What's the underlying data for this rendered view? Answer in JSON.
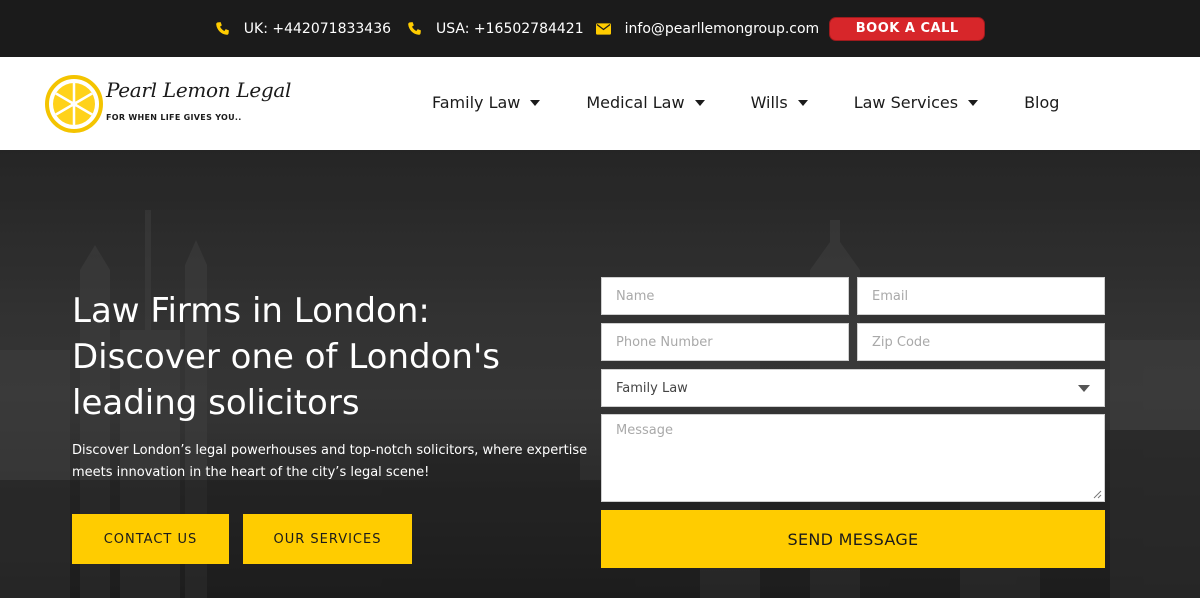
{
  "topbar": {
    "uk_phone": "UK: +442071833436",
    "usa_phone": "USA: +16502784421",
    "email": "info@pearllemongroup.com",
    "book_label": "BOOK A CALL",
    "icons": [
      "phone-icon",
      "phone-icon",
      "envelope-icon"
    ],
    "icon_color": "#ffcc00"
  },
  "header": {
    "logo_title": "Pearl Lemon Legal",
    "logo_tagline": "FOR WHEN LIFE GIVES YOU..",
    "nav": [
      {
        "label": "Family Law",
        "dropdown": true
      },
      {
        "label": "Medical Law",
        "dropdown": true
      },
      {
        "label": "Wills",
        "dropdown": true
      },
      {
        "label": "Law Services",
        "dropdown": true
      },
      {
        "label": "Blog",
        "dropdown": false
      }
    ]
  },
  "hero": {
    "title_lines": [
      "Law Firms in London:",
      "Discover one of London's",
      "leading solicitors"
    ],
    "subtitle_lines": [
      "Discover London’s legal powerhouses and top-notch solicitors, where expertise",
      "meets innovation in the heart of the city’s legal scene!"
    ],
    "contact_label": "CONTACT US",
    "services_label": "OUR SERVICES"
  },
  "form": {
    "name_placeholder": "Name",
    "email_placeholder": "Email",
    "phone_placeholder": "Phone Number",
    "zip_placeholder": "Zip Code",
    "service_selected": "Family Law",
    "message_placeholder": "Message",
    "send_label": "SEND MESSAGE"
  },
  "colors": {
    "accent_yellow": "#ffcc00",
    "book_red": "#d7262a",
    "topbar_bg": "#1b1b1b"
  }
}
